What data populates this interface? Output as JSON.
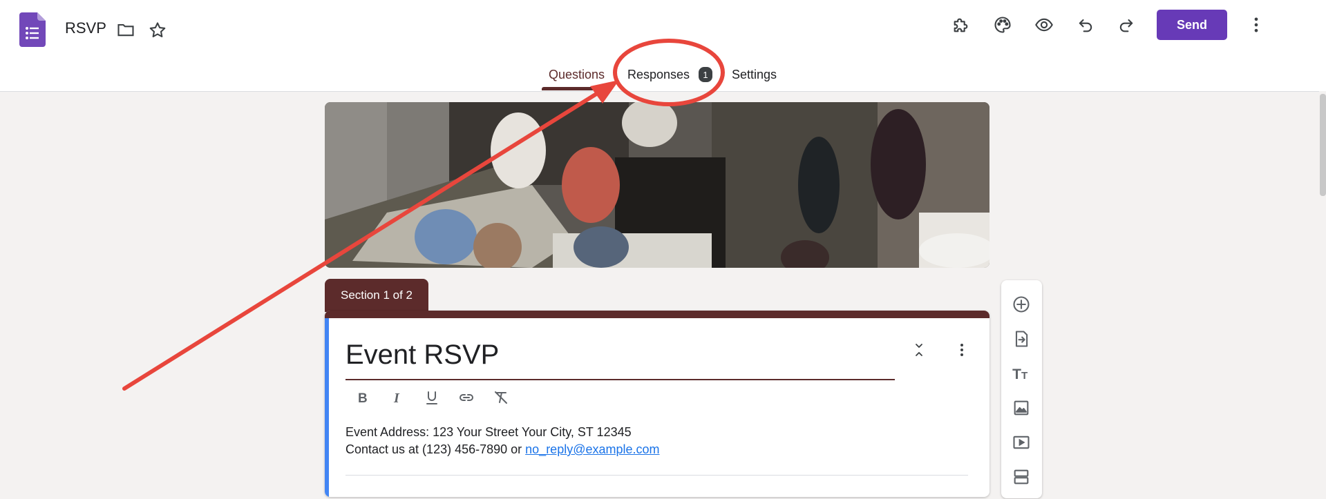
{
  "header": {
    "doc_title": "RSVP",
    "icons": [
      "forms-logo-icon",
      "folder-icon",
      "star-icon",
      "addons-icon",
      "palette-icon",
      "preview-icon",
      "undo-icon",
      "redo-icon",
      "more-vert-icon"
    ],
    "send_label": "Send"
  },
  "tabs": {
    "questions": "Questions",
    "responses": "Responses",
    "responses_count": "1",
    "settings": "Settings",
    "active": "Questions"
  },
  "section": {
    "label": "Section 1 of 2"
  },
  "form": {
    "title": "Event RSVP",
    "format_tools": [
      "bold-icon",
      "italic-icon",
      "underline-icon",
      "link-icon",
      "clear-format-icon"
    ],
    "description_line1": "Event Address: 123 Your Street Your City, ST 12345",
    "description_line2_prefix": "Contact us at (123) 456-7890 or ",
    "description_email": "no_reply@example.com"
  },
  "sidebar": {
    "tools": [
      "add-question-icon",
      "import-questions-icon",
      "add-title-icon",
      "add-image-icon",
      "add-video-icon",
      "add-section-icon"
    ]
  },
  "colors": {
    "theme": "#5c2b2b",
    "send_button": "#673ab7",
    "accent_bar": "#4285f4",
    "background": "#f4f2f1",
    "annotation": "#e8463c"
  }
}
